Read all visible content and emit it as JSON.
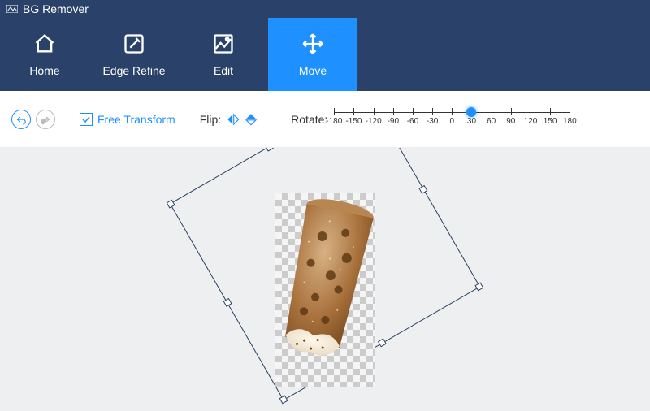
{
  "title": "BG Remover",
  "nav": {
    "tabs": [
      {
        "label": "Home"
      },
      {
        "label": "Edge Refine"
      },
      {
        "label": "Edit"
      },
      {
        "label": "Move"
      }
    ],
    "active_index": 3
  },
  "toolbar": {
    "free_transform_label": "Free Transform",
    "free_transform_checked": true,
    "flip_label": "Flip:",
    "rotate_label": "Rotate:",
    "rotate_ticks": [
      -180,
      -150,
      -120,
      -90,
      -60,
      -30,
      0,
      30,
      60,
      90,
      120,
      150,
      180
    ],
    "rotate_min": -180,
    "rotate_max": 180,
    "rotate_value": 30
  },
  "canvas": {
    "rotation_deg": 30
  },
  "colors": {
    "accent": "#1e90ff",
    "header": "#2a4269"
  }
}
